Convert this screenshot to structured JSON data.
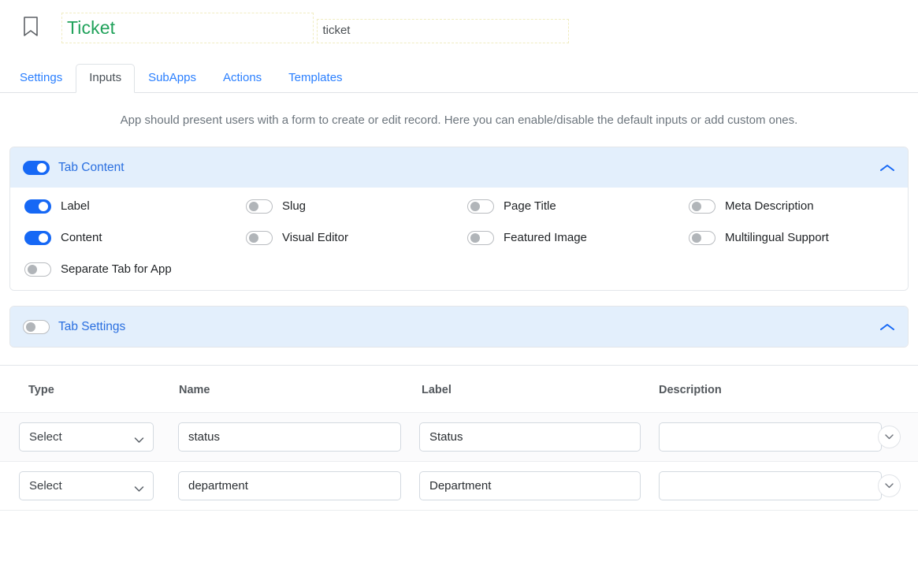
{
  "header": {
    "bookmark_icon": "bookmark-icon",
    "title": "Ticket",
    "slug": "ticket"
  },
  "tabs": [
    {
      "label": "Settings",
      "active": false
    },
    {
      "label": "Inputs",
      "active": true
    },
    {
      "label": "SubApps",
      "active": false
    },
    {
      "label": "Actions",
      "active": false
    },
    {
      "label": "Templates",
      "active": false
    }
  ],
  "description": "App should present users with a form to create or edit record. Here you can enable/disable the default inputs or add custom ones.",
  "sections": [
    {
      "title": "Tab Content",
      "enabled": true,
      "collapse_icon": "chevron-up-icon",
      "options": [
        {
          "label": "Label",
          "enabled": true
        },
        {
          "label": "Slug",
          "enabled": false
        },
        {
          "label": "Page Title",
          "enabled": false
        },
        {
          "label": "Meta Description",
          "enabled": false
        },
        {
          "label": "Content",
          "enabled": true
        },
        {
          "label": "Visual Editor",
          "enabled": false
        },
        {
          "label": "Featured Image",
          "enabled": false
        },
        {
          "label": "Multilingual Support",
          "enabled": false
        },
        {
          "label": "Separate Tab for App",
          "enabled": false
        }
      ]
    },
    {
      "title": "Tab Settings",
      "enabled": false,
      "collapse_icon": "chevron-up-icon",
      "options": []
    }
  ],
  "table": {
    "columns": [
      "Type",
      "Name",
      "Label",
      "Description"
    ],
    "select_placeholder": "Select",
    "rows": [
      {
        "type": "Select",
        "name": "status",
        "label": "Status",
        "description": ""
      },
      {
        "type": "Select",
        "name": "department",
        "label": "Department",
        "description": ""
      }
    ],
    "expand_icon": "chevron-down-icon"
  },
  "colors": {
    "accent_blue": "#1668f5",
    "link_blue": "#2a7fff",
    "title_green": "#21a25b",
    "section_header_bg": "#e3effc"
  }
}
